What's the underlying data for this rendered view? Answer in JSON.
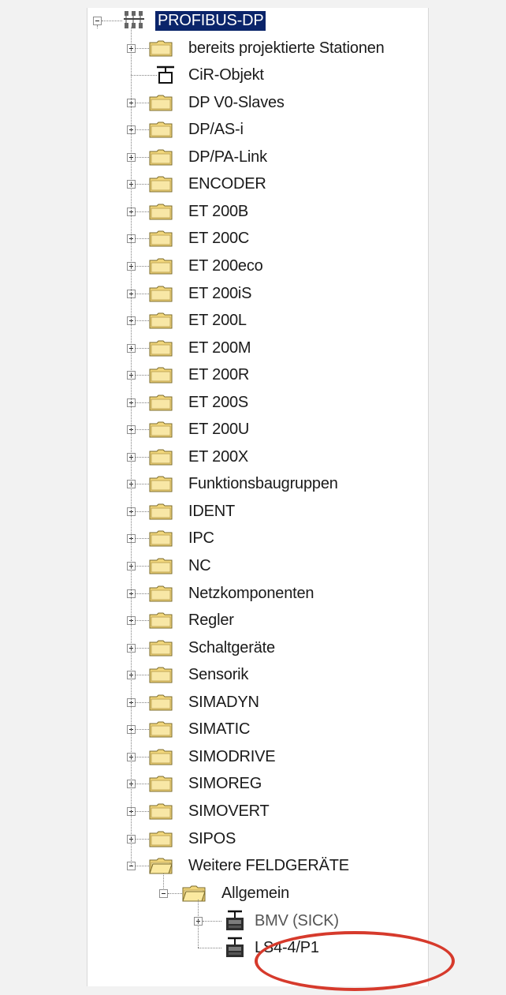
{
  "tree": {
    "root": {
      "label": "PROFIBUS-DP",
      "expanded": true,
      "selected": true
    },
    "items": [
      {
        "label": "bereits projektierte Stationen",
        "type": "folder",
        "expanded": false
      },
      {
        "label": "CiR-Objekt",
        "type": "cir-object"
      },
      {
        "label": "DP V0-Slaves",
        "type": "folder",
        "expanded": false
      },
      {
        "label": "DP/AS-i",
        "type": "folder",
        "expanded": false
      },
      {
        "label": "DP/PA-Link",
        "type": "folder",
        "expanded": false
      },
      {
        "label": "ENCODER",
        "type": "folder",
        "expanded": false
      },
      {
        "label": "ET 200B",
        "type": "folder",
        "expanded": false
      },
      {
        "label": "ET 200C",
        "type": "folder",
        "expanded": false
      },
      {
        "label": "ET 200eco",
        "type": "folder",
        "expanded": false
      },
      {
        "label": "ET 200iS",
        "type": "folder",
        "expanded": false
      },
      {
        "label": "ET 200L",
        "type": "folder",
        "expanded": false
      },
      {
        "label": "ET 200M",
        "type": "folder",
        "expanded": false
      },
      {
        "label": "ET 200R",
        "type": "folder",
        "expanded": false
      },
      {
        "label": "ET 200S",
        "type": "folder",
        "expanded": false
      },
      {
        "label": "ET 200U",
        "type": "folder",
        "expanded": false
      },
      {
        "label": "ET 200X",
        "type": "folder",
        "expanded": false
      },
      {
        "label": "Funktionsbaugruppen",
        "type": "folder",
        "expanded": false
      },
      {
        "label": "IDENT",
        "type": "folder",
        "expanded": false
      },
      {
        "label": "IPC",
        "type": "folder",
        "expanded": false
      },
      {
        "label": "NC",
        "type": "folder",
        "expanded": false
      },
      {
        "label": "Netzkomponenten",
        "type": "folder",
        "expanded": false
      },
      {
        "label": "Regler",
        "type": "folder",
        "expanded": false
      },
      {
        "label": "Schaltgeräte",
        "type": "folder",
        "expanded": false
      },
      {
        "label": "Sensorik",
        "type": "folder",
        "expanded": false
      },
      {
        "label": "SIMADYN",
        "type": "folder",
        "expanded": false
      },
      {
        "label": "SIMATIC",
        "type": "folder",
        "expanded": false
      },
      {
        "label": "SIMODRIVE",
        "type": "folder",
        "expanded": false
      },
      {
        "label": "SIMOREG",
        "type": "folder",
        "expanded": false
      },
      {
        "label": "SIMOVERT",
        "type": "folder",
        "expanded": false
      },
      {
        "label": "SIPOS",
        "type": "folder",
        "expanded": false
      },
      {
        "label": "Weitere FELDGERÄTE",
        "type": "folder",
        "expanded": true
      }
    ],
    "subfolder": {
      "label": "Allgemein",
      "expanded": true
    },
    "devices": [
      {
        "label": "BMV (SICK)",
        "type": "device",
        "has_expander": true
      },
      {
        "label": "LS4-4/P1",
        "type": "device",
        "has_expander": false,
        "highlighted": true
      }
    ]
  },
  "colors": {
    "selection": "#0a246a",
    "folder": "#f2d77c",
    "highlight_ring": "#d63a2c"
  },
  "icons": {
    "root": "network-icon",
    "folder": "folder-icon",
    "cir": "cir-object-icon",
    "device": "device-icon"
  }
}
